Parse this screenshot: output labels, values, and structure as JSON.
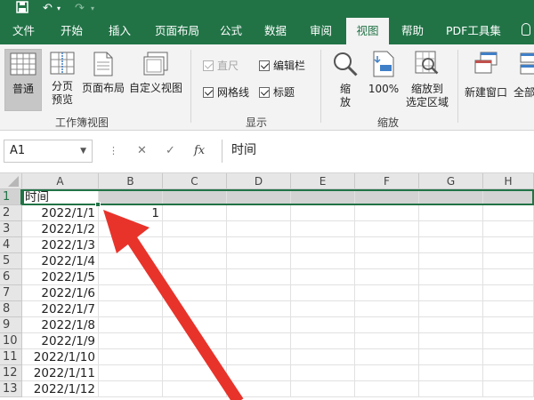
{
  "tabs": [
    {
      "label": "文件",
      "active": false
    },
    {
      "label": "开始",
      "active": false
    },
    {
      "label": "插入",
      "active": false
    },
    {
      "label": "页面布局",
      "active": false
    },
    {
      "label": "公式",
      "active": false
    },
    {
      "label": "数据",
      "active": false
    },
    {
      "label": "审阅",
      "active": false
    },
    {
      "label": "视图",
      "active": true
    },
    {
      "label": "帮助",
      "active": false
    },
    {
      "label": "PDF工具集",
      "active": false
    }
  ],
  "ribbon": {
    "workbook_views": {
      "group_label": "工作簿视图",
      "normal": "普通",
      "page_break_l1": "分页",
      "page_break_l2": "预览",
      "page_layout": "页面布局",
      "custom_view": "自定义视图"
    },
    "show": {
      "group_label": "显示",
      "ruler": "直尺",
      "formula_bar": "编辑栏",
      "gridlines": "网格线",
      "headings": "标题"
    },
    "zoom": {
      "group_label": "缩放",
      "zoom_l1": "缩",
      "zoom_l2": "放",
      "hundred": "100%",
      "to_selection_l1": "缩放到",
      "to_selection_l2": "选定区域"
    },
    "window": {
      "new_window": "新建窗口",
      "arrange_all": "全部"
    }
  },
  "formula_bar": {
    "name_box": "A1",
    "fx": "fx",
    "content": "时间"
  },
  "grid": {
    "columns": [
      "A",
      "B",
      "C",
      "D",
      "E",
      "F",
      "G",
      "H"
    ],
    "rows": [
      "1",
      "2",
      "3",
      "4",
      "5",
      "6",
      "7",
      "8",
      "9",
      "10",
      "11",
      "12",
      "13"
    ],
    "a_values": [
      "时间",
      "2022/1/1",
      "2022/1/2",
      "2022/1/3",
      "2022/1/4",
      "2022/1/5",
      "2022/1/6",
      "2022/1/7",
      "2022/1/8",
      "2022/1/9",
      "2022/1/10",
      "2022/1/11",
      "2022/1/12"
    ],
    "b2_value": "1"
  },
  "colors": {
    "excel_green": "#217346",
    "arrow_red": "#e8332b"
  }
}
